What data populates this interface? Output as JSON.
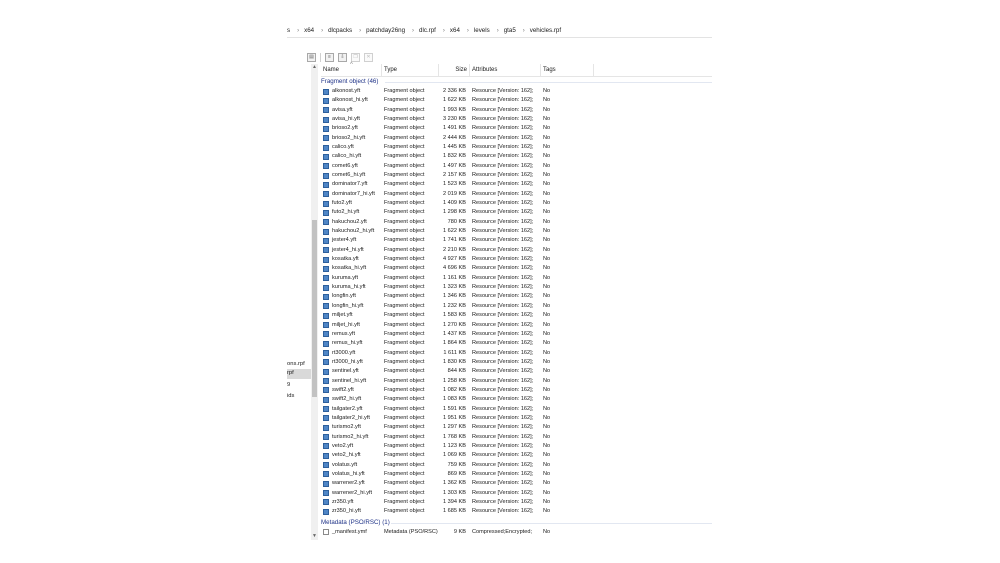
{
  "breadcrumb": [
    "s",
    "x64",
    "dlcpacks",
    "patchday26ng",
    "dlc.rpf",
    "x64",
    "levels",
    "gta5",
    "vehicles.rpf"
  ],
  "nav_items": [
    "ons.rpf",
    "rpf",
    "9",
    "ids"
  ],
  "columns": {
    "name": "Name",
    "type": "Type",
    "size": "Size",
    "attributes": "Attributes",
    "tags": "Tags"
  },
  "groups": {
    "fragment": "Fragment object (46)",
    "metadata": "Metadata (PSO/RSC) (1)"
  },
  "fragment_rows": [
    {
      "name": "alkonost.yft",
      "type": "Fragment object",
      "size": "2 336 KB",
      "attr": "Resource [Version: 162];",
      "tags": "No"
    },
    {
      "name": "alkonost_hi.yft",
      "type": "Fragment object",
      "size": "1 622 KB",
      "attr": "Resource [Version: 162];",
      "tags": "No"
    },
    {
      "name": "avisa.yft",
      "type": "Fragment object",
      "size": "1 993 KB",
      "attr": "Resource [Version: 162];",
      "tags": "No"
    },
    {
      "name": "avisa_hi.yft",
      "type": "Fragment object",
      "size": "3 230 KB",
      "attr": "Resource [Version: 162];",
      "tags": "No"
    },
    {
      "name": "brioso2.yft",
      "type": "Fragment object",
      "size": "1 491 KB",
      "attr": "Resource [Version: 162];",
      "tags": "No"
    },
    {
      "name": "brioso2_hi.yft",
      "type": "Fragment object",
      "size": "2 444 KB",
      "attr": "Resource [Version: 162];",
      "tags": "No"
    },
    {
      "name": "calico.yft",
      "type": "Fragment object",
      "size": "1 445 KB",
      "attr": "Resource [Version: 162];",
      "tags": "No"
    },
    {
      "name": "calico_hi.yft",
      "type": "Fragment object",
      "size": "1 832 KB",
      "attr": "Resource [Version: 162];",
      "tags": "No"
    },
    {
      "name": "comet6.yft",
      "type": "Fragment object",
      "size": "1 497 KB",
      "attr": "Resource [Version: 162];",
      "tags": "No"
    },
    {
      "name": "comet6_hi.yft",
      "type": "Fragment object",
      "size": "2 157 KB",
      "attr": "Resource [Version: 162];",
      "tags": "No"
    },
    {
      "name": "dominator7.yft",
      "type": "Fragment object",
      "size": "1 523 KB",
      "attr": "Resource [Version: 162];",
      "tags": "No"
    },
    {
      "name": "dominator7_hi.yft",
      "type": "Fragment object",
      "size": "2 019 KB",
      "attr": "Resource [Version: 162];",
      "tags": "No"
    },
    {
      "name": "futo2.yft",
      "type": "Fragment object",
      "size": "1 409 KB",
      "attr": "Resource [Version: 162];",
      "tags": "No"
    },
    {
      "name": "futo2_hi.yft",
      "type": "Fragment object",
      "size": "1 298 KB",
      "attr": "Resource [Version: 162];",
      "tags": "No"
    },
    {
      "name": "hakuchou2.yft",
      "type": "Fragment object",
      "size": "780 KB",
      "attr": "Resource [Version: 162];",
      "tags": "No"
    },
    {
      "name": "hakuchou2_hi.yft",
      "type": "Fragment object",
      "size": "1 622 KB",
      "attr": "Resource [Version: 162];",
      "tags": "No"
    },
    {
      "name": "jester4.yft",
      "type": "Fragment object",
      "size": "1 741 KB",
      "attr": "Resource [Version: 162];",
      "tags": "No"
    },
    {
      "name": "jester4_hi.yft",
      "type": "Fragment object",
      "size": "2 210 KB",
      "attr": "Resource [Version: 162];",
      "tags": "No"
    },
    {
      "name": "kosatka.yft",
      "type": "Fragment object",
      "size": "4 927 KB",
      "attr": "Resource [Version: 162];",
      "tags": "No"
    },
    {
      "name": "kosatka_hi.yft",
      "type": "Fragment object",
      "size": "4 696 KB",
      "attr": "Resource [Version: 162];",
      "tags": "No"
    },
    {
      "name": "kuruma.yft",
      "type": "Fragment object",
      "size": "1 161 KB",
      "attr": "Resource [Version: 162];",
      "tags": "No"
    },
    {
      "name": "kuruma_hi.yft",
      "type": "Fragment object",
      "size": "1 323 KB",
      "attr": "Resource [Version: 162];",
      "tags": "No"
    },
    {
      "name": "longfin.yft",
      "type": "Fragment object",
      "size": "1 346 KB",
      "attr": "Resource [Version: 162];",
      "tags": "No"
    },
    {
      "name": "longfin_hi.yft",
      "type": "Fragment object",
      "size": "1 232 KB",
      "attr": "Resource [Version: 162];",
      "tags": "No"
    },
    {
      "name": "miljet.yft",
      "type": "Fragment object",
      "size": "1 583 KB",
      "attr": "Resource [Version: 162];",
      "tags": "No"
    },
    {
      "name": "miljet_hi.yft",
      "type": "Fragment object",
      "size": "1 270 KB",
      "attr": "Resource [Version: 162];",
      "tags": "No"
    },
    {
      "name": "remus.yft",
      "type": "Fragment object",
      "size": "1 437 KB",
      "attr": "Resource [Version: 162];",
      "tags": "No"
    },
    {
      "name": "remus_hi.yft",
      "type": "Fragment object",
      "size": "1 864 KB",
      "attr": "Resource [Version: 162];",
      "tags": "No"
    },
    {
      "name": "rt3000.yft",
      "type": "Fragment object",
      "size": "1 611 KB",
      "attr": "Resource [Version: 162];",
      "tags": "No"
    },
    {
      "name": "rt3000_hi.yft",
      "type": "Fragment object",
      "size": "1 830 KB",
      "attr": "Resource [Version: 162];",
      "tags": "No"
    },
    {
      "name": "sentinel.yft",
      "type": "Fragment object",
      "size": "844 KB",
      "attr": "Resource [Version: 162];",
      "tags": "No"
    },
    {
      "name": "sentinel_hi.yft",
      "type": "Fragment object",
      "size": "1 258 KB",
      "attr": "Resource [Version: 162];",
      "tags": "No"
    },
    {
      "name": "swift2.yft",
      "type": "Fragment object",
      "size": "1 082 KB",
      "attr": "Resource [Version: 162];",
      "tags": "No"
    },
    {
      "name": "swift2_hi.yft",
      "type": "Fragment object",
      "size": "1 083 KB",
      "attr": "Resource [Version: 162];",
      "tags": "No"
    },
    {
      "name": "tailgater2.yft",
      "type": "Fragment object",
      "size": "1 591 KB",
      "attr": "Resource [Version: 162];",
      "tags": "No"
    },
    {
      "name": "tailgater2_hi.yft",
      "type": "Fragment object",
      "size": "1 951 KB",
      "attr": "Resource [Version: 162];",
      "tags": "No"
    },
    {
      "name": "turismo2.yft",
      "type": "Fragment object",
      "size": "1 297 KB",
      "attr": "Resource [Version: 162];",
      "tags": "No"
    },
    {
      "name": "turismo2_hi.yft",
      "type": "Fragment object",
      "size": "1 768 KB",
      "attr": "Resource [Version: 162];",
      "tags": "No"
    },
    {
      "name": "veto2.yft",
      "type": "Fragment object",
      "size": "1 123 KB",
      "attr": "Resource [Version: 162];",
      "tags": "No"
    },
    {
      "name": "veto2_hi.yft",
      "type": "Fragment object",
      "size": "1 069 KB",
      "attr": "Resource [Version: 162];",
      "tags": "No"
    },
    {
      "name": "volatus.yft",
      "type": "Fragment object",
      "size": "759 KB",
      "attr": "Resource [Version: 162];",
      "tags": "No"
    },
    {
      "name": "volatus_hi.yft",
      "type": "Fragment object",
      "size": "869 KB",
      "attr": "Resource [Version: 162];",
      "tags": "No"
    },
    {
      "name": "warrener2.yft",
      "type": "Fragment object",
      "size": "1 362 KB",
      "attr": "Resource [Version: 162];",
      "tags": "No"
    },
    {
      "name": "warrener2_hi.yft",
      "type": "Fragment object",
      "size": "1 303 KB",
      "attr": "Resource [Version: 162];",
      "tags": "No"
    },
    {
      "name": "zr350.yft",
      "type": "Fragment object",
      "size": "1 394 KB",
      "attr": "Resource [Version: 162];",
      "tags": "No"
    },
    {
      "name": "zr350_hi.yft",
      "type": "Fragment object",
      "size": "1 685 KB",
      "attr": "Resource [Version: 162];",
      "tags": "No"
    }
  ],
  "metadata_rows": [
    {
      "name": "_manifest.ymf",
      "type": "Metadata (PSO/RSC)",
      "size": "9 KB",
      "attr": "Compressed;Encrypted;",
      "tags": "No"
    }
  ],
  "icons": {
    "file": "fragment-file-icon",
    "doc": "metadata-file-icon"
  },
  "colors": {
    "group_header": "#1e3287",
    "selected_nav": "#d9d9d9",
    "scroll_thumb": "#c2c2c2"
  }
}
